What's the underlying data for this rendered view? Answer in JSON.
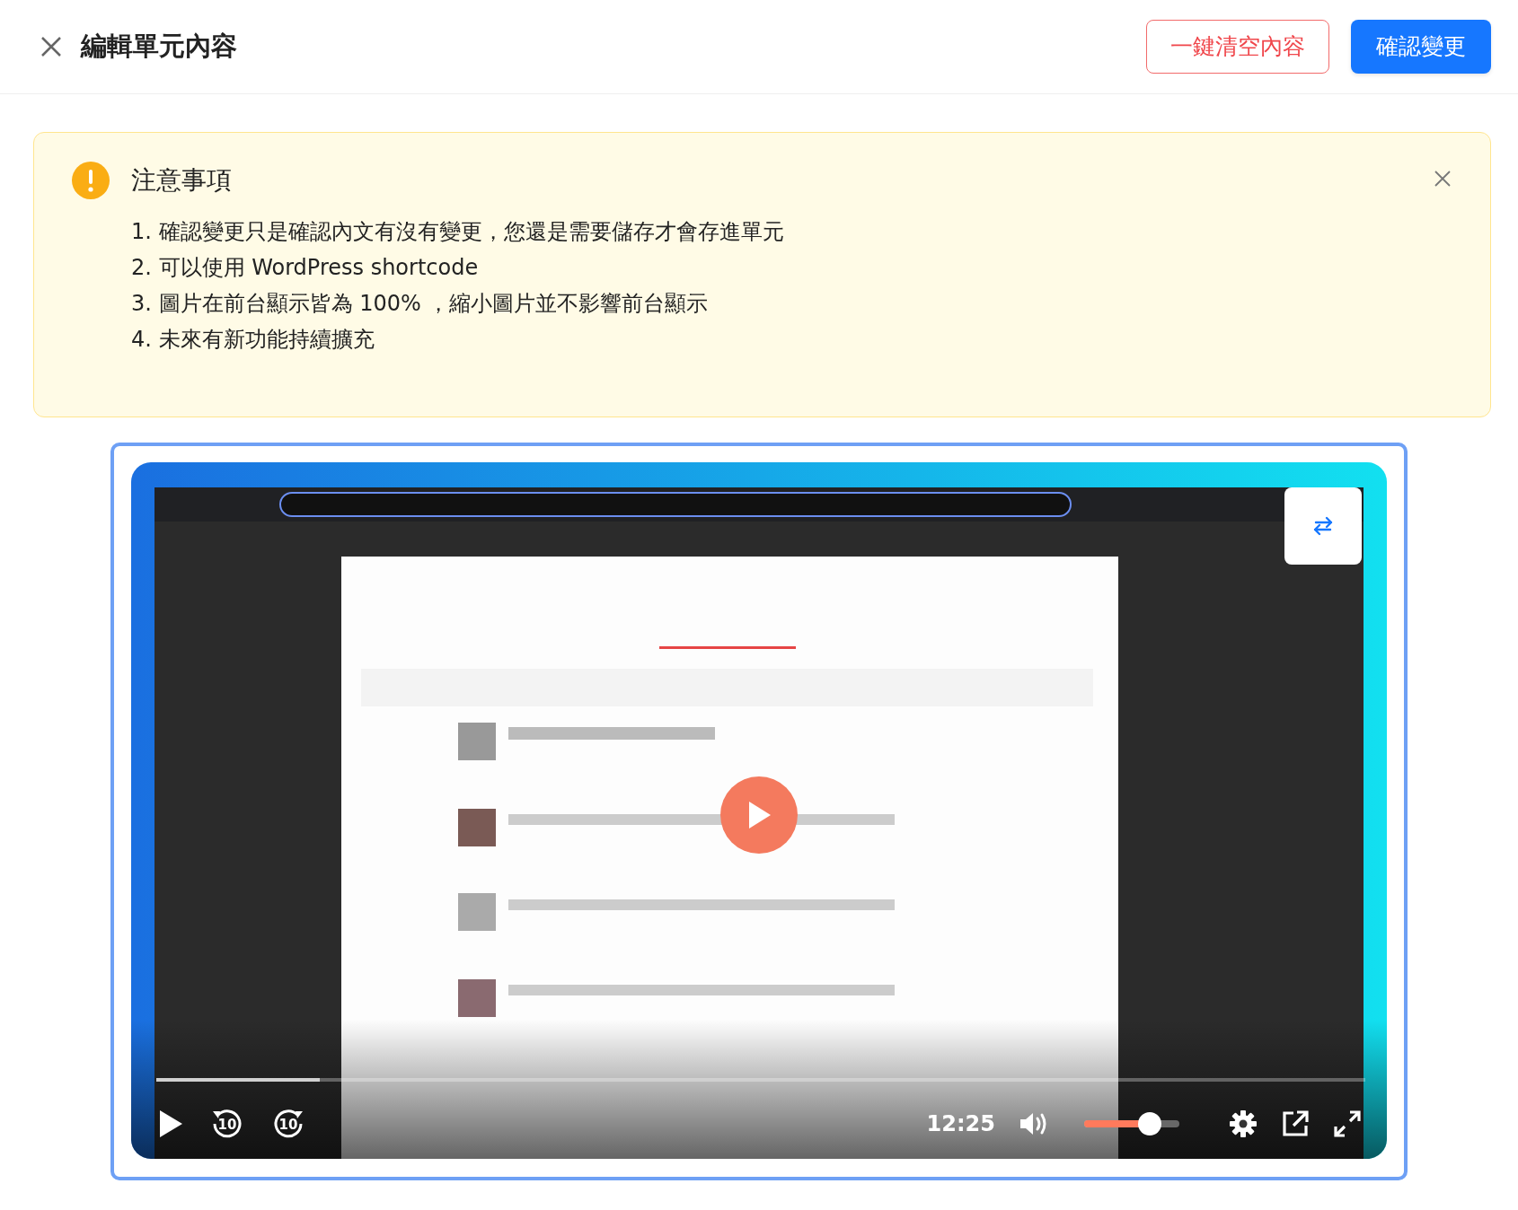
{
  "header": {
    "title": "編輯單元內容",
    "buttons": [
      {
        "label": "一鍵清空內容",
        "kind": "danger"
      },
      {
        "label": "確認變更",
        "kind": "primary"
      }
    ]
  },
  "notice": {
    "title": "注意事項",
    "items": [
      "1. 確認變更只是確認內文有沒有變更，您還是需要儲存才會存進單元",
      "2. 可以使用 WordPress shortcode",
      "3. 圖片在前台顯示皆為 100% ，縮小圖片並不影響前台顯示",
      "4. 未來有新功能持續擴充"
    ]
  },
  "video": {
    "kind": "picture",
    "playing": false,
    "progress": {
      "level": 0.135
    },
    "rewind_label": "10",
    "forward_label": "10",
    "time": "12:25",
    "volume": {
      "level": 0.69
    }
  }
}
